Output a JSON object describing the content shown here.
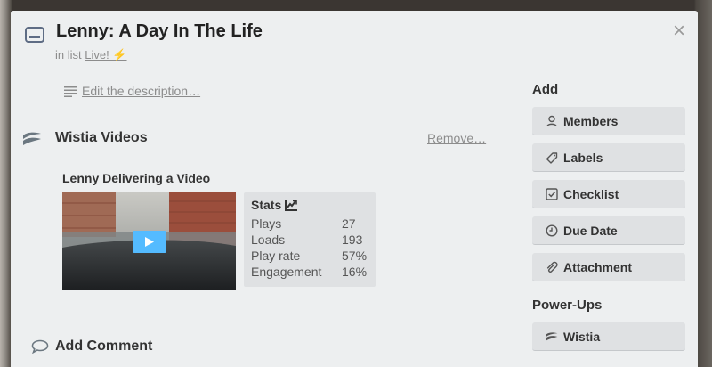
{
  "card": {
    "title": "Lenny: A Day In The Life",
    "list_prefix": "in list",
    "list_name": "Live! ⚡",
    "close_glyph": "×"
  },
  "description": {
    "edit_link": "Edit the description…"
  },
  "wistia_section": {
    "title": "Wistia Videos",
    "remove_link": "Remove…",
    "video": {
      "title": "Lenny Delivering a Video",
      "stats": {
        "title": "Stats",
        "rows": [
          {
            "label": "Plays",
            "value": "27"
          },
          {
            "label": "Loads",
            "value": "193"
          },
          {
            "label": "Play rate",
            "value": "57%"
          },
          {
            "label": "Engagement",
            "value": "16%"
          }
        ]
      }
    }
  },
  "comment": {
    "title": "Add Comment"
  },
  "sidebar": {
    "add_heading": "Add",
    "add_buttons": [
      {
        "label": "Members",
        "icon": "person-icon"
      },
      {
        "label": "Labels",
        "icon": "tag-icon"
      },
      {
        "label": "Checklist",
        "icon": "checkbox-icon"
      },
      {
        "label": "Due Date",
        "icon": "clock-icon"
      },
      {
        "label": "Attachment",
        "icon": "paperclip-icon"
      }
    ],
    "powerups_heading": "Power-Ups",
    "powerups_buttons": [
      {
        "label": "Wistia",
        "icon": "wistia-icon"
      }
    ]
  },
  "colors": {
    "modal_bg": "#edeff0",
    "button_bg": "#dfe1e3",
    "play_button": "#54bbff",
    "muted_text": "#8c8c8c"
  }
}
